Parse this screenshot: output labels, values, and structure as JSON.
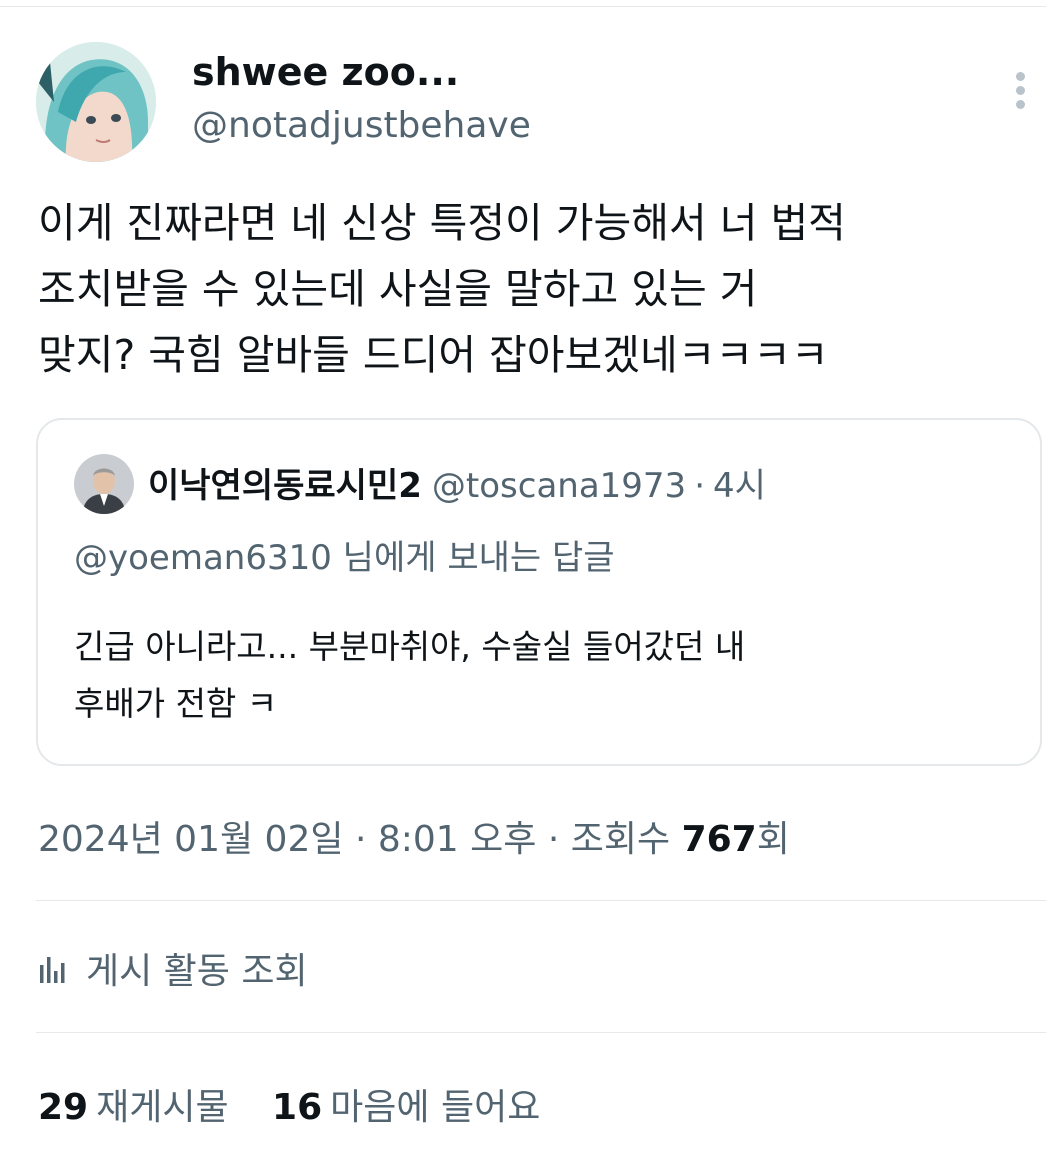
{
  "author": {
    "name": "shwee zoo...",
    "handle": "@notadjustbehave"
  },
  "tweet": {
    "lines": [
      "이게 진짜라면 네 신상 특정이 가능해서 너 법적",
      "조치받을 수 있는데 사실을 말하고 있는 거",
      "맞지? 국힘 알바들 드디어 잡아보겠네ㅋㅋㅋㅋ"
    ]
  },
  "quote": {
    "name": "이낙연의동료시민2",
    "handle": "@toscana1973",
    "separator": "·",
    "time": "4시",
    "reply_to": "@yoeman6310 님에게 보내는 답글",
    "lines": [
      "긴급 아니라고... 부분마취야, 수술실 들어갔던 내",
      "후배가 전함 ㅋ"
    ]
  },
  "meta": {
    "date": "2024년 01월 02일",
    "sep1": "·",
    "time": "8:01 오후",
    "sep2": "·",
    "views_label": "조회수",
    "views_count": "767",
    "views_suffix": "회"
  },
  "activity": {
    "icon": "bar-chart-icon",
    "label": "게시 활동 조회"
  },
  "stats": {
    "reposts_count": "29",
    "reposts_label": "재게시물",
    "likes_count": "16",
    "likes_label": "마음에 들어요"
  },
  "colors": {
    "primary_text": "#0f1419",
    "secondary_text": "#536471",
    "border": "#e4e8eb"
  }
}
